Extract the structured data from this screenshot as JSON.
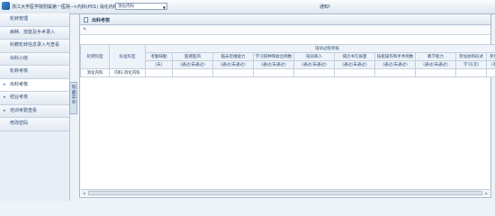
{
  "header": {
    "breadcrumb": "浙江大学医学院附属第一医院-->内科(P01) 消化内科",
    "department_select": "消化内科",
    "notice": "通知!"
  },
  "sidebar": {
    "items": [
      {
        "label": "轮转管理"
      },
      {
        "label": "病种、技能及手术录入"
      },
      {
        "label": "科教轮转信息录入与查看"
      },
      {
        "label": "出科小结"
      },
      {
        "label": "轮转考核"
      },
      {
        "label": "出科考核"
      },
      {
        "label": "结业考核"
      },
      {
        "label": "培训考勤查看"
      },
      {
        "label": "修改密码"
      }
    ],
    "collapse_label": "隐藏菜单"
  },
  "main": {
    "title": "出科考核",
    "table": {
      "group_header": "培训过程考核",
      "col_rotation_dept": "轮转科室",
      "col_standard_dept": "标准科室",
      "columns": [
        {
          "name": "考勤缺勤",
          "sub": "(天)"
        },
        {
          "name": "医德医风",
          "sub": "(通过/未通过)"
        },
        {
          "name": "临床思维能力",
          "sub": "(通过/未通过)"
        },
        {
          "name": "学习病种和收治例数",
          "sub": "(通过/未通过)"
        },
        {
          "name": "培训病人",
          "sub": "(通过/未通过)"
        },
        {
          "name": "病历书写质量",
          "sub": "(通过/未通过)"
        },
        {
          "name": "技能操作和手术例数",
          "sub": "(通过/未通过)"
        },
        {
          "name": "教学能力",
          "sub": "(通过/未通过)"
        },
        {
          "name": "参加会和形式",
          "sub": "学习(次)"
        },
        {
          "name": "参加科研",
          "sub": "(有/无)"
        }
      ],
      "rows": [
        {
          "rotation_dept": "消化内科",
          "standard_dept": "内科-消化内科"
        }
      ]
    }
  }
}
